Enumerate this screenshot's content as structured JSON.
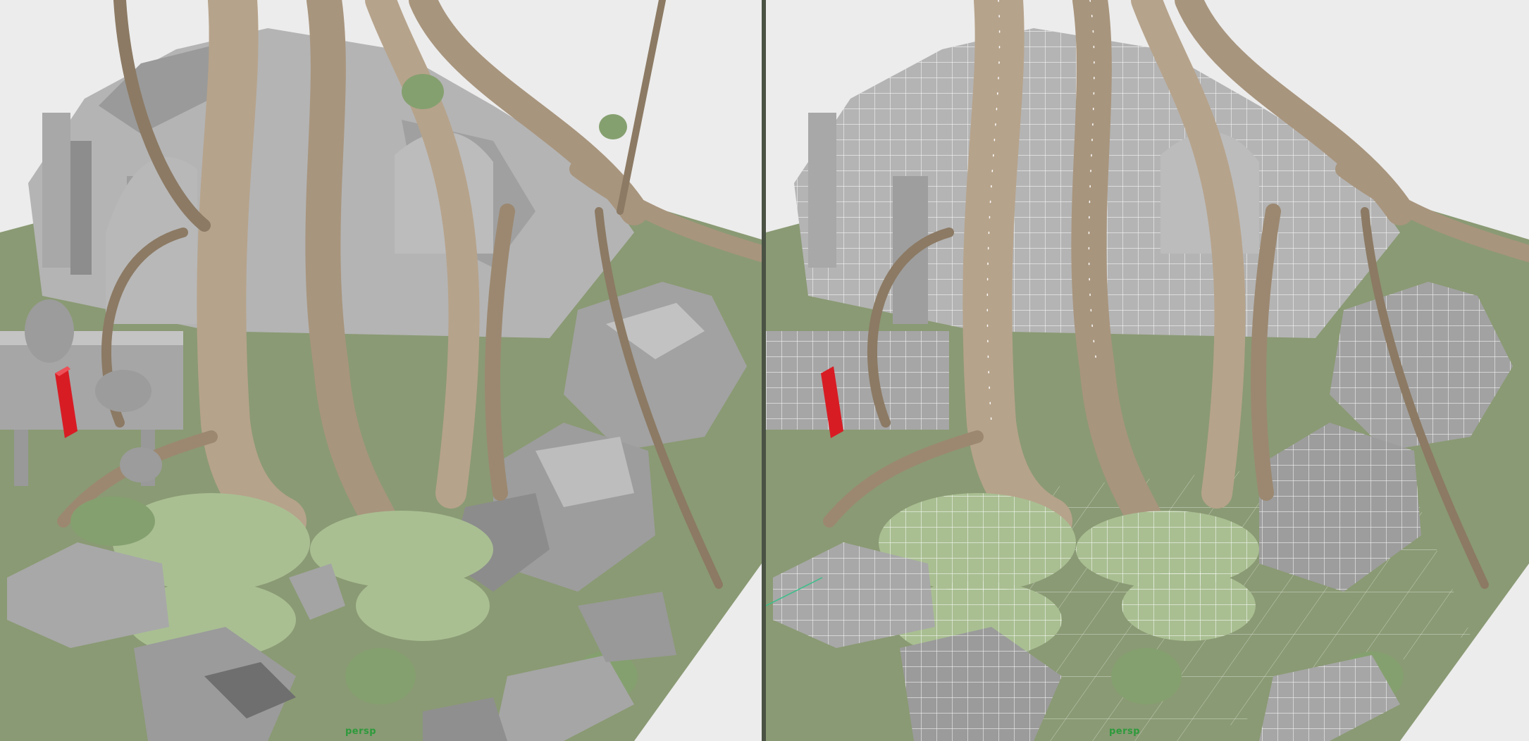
{
  "viewports": {
    "left": {
      "camera": "persp",
      "display_mode": "smooth-shaded"
    },
    "right": {
      "camera": "persp",
      "display_mode": "wireframe-on-shaded"
    }
  },
  "colors": {
    "background": "#ececec",
    "ground": "#8a9a74",
    "stone": "#a6a6a6",
    "stone_dark": "#7f7f7f",
    "stone_light": "#c4c4c4",
    "root": "#b6a38b",
    "root_dark": "#8c7a64",
    "foliage": "#a9bf92",
    "foliage_dark": "#85a06f",
    "marker_red": "#d81c24",
    "wire": "#ffffff",
    "label": "#2d9a3c"
  }
}
